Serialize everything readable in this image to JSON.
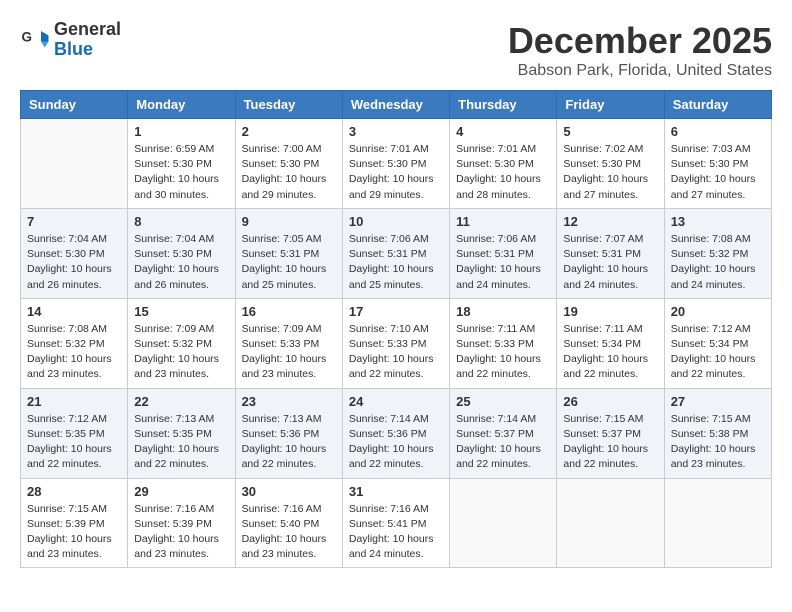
{
  "logo": {
    "general": "General",
    "blue": "Blue"
  },
  "header": {
    "month": "December 2025",
    "location": "Babson Park, Florida, United States"
  },
  "weekdays": [
    "Sunday",
    "Monday",
    "Tuesday",
    "Wednesday",
    "Thursday",
    "Friday",
    "Saturday"
  ],
  "weeks": [
    [
      {
        "day": "",
        "sunrise": "",
        "sunset": "",
        "daylight": ""
      },
      {
        "day": "1",
        "sunrise": "Sunrise: 6:59 AM",
        "sunset": "Sunset: 5:30 PM",
        "daylight": "Daylight: 10 hours and 30 minutes."
      },
      {
        "day": "2",
        "sunrise": "Sunrise: 7:00 AM",
        "sunset": "Sunset: 5:30 PM",
        "daylight": "Daylight: 10 hours and 29 minutes."
      },
      {
        "day": "3",
        "sunrise": "Sunrise: 7:01 AM",
        "sunset": "Sunset: 5:30 PM",
        "daylight": "Daylight: 10 hours and 29 minutes."
      },
      {
        "day": "4",
        "sunrise": "Sunrise: 7:01 AM",
        "sunset": "Sunset: 5:30 PM",
        "daylight": "Daylight: 10 hours and 28 minutes."
      },
      {
        "day": "5",
        "sunrise": "Sunrise: 7:02 AM",
        "sunset": "Sunset: 5:30 PM",
        "daylight": "Daylight: 10 hours and 27 minutes."
      },
      {
        "day": "6",
        "sunrise": "Sunrise: 7:03 AM",
        "sunset": "Sunset: 5:30 PM",
        "daylight": "Daylight: 10 hours and 27 minutes."
      }
    ],
    [
      {
        "day": "7",
        "sunrise": "Sunrise: 7:04 AM",
        "sunset": "Sunset: 5:30 PM",
        "daylight": "Daylight: 10 hours and 26 minutes."
      },
      {
        "day": "8",
        "sunrise": "Sunrise: 7:04 AM",
        "sunset": "Sunset: 5:30 PM",
        "daylight": "Daylight: 10 hours and 26 minutes."
      },
      {
        "day": "9",
        "sunrise": "Sunrise: 7:05 AM",
        "sunset": "Sunset: 5:31 PM",
        "daylight": "Daylight: 10 hours and 25 minutes."
      },
      {
        "day": "10",
        "sunrise": "Sunrise: 7:06 AM",
        "sunset": "Sunset: 5:31 PM",
        "daylight": "Daylight: 10 hours and 25 minutes."
      },
      {
        "day": "11",
        "sunrise": "Sunrise: 7:06 AM",
        "sunset": "Sunset: 5:31 PM",
        "daylight": "Daylight: 10 hours and 24 minutes."
      },
      {
        "day": "12",
        "sunrise": "Sunrise: 7:07 AM",
        "sunset": "Sunset: 5:31 PM",
        "daylight": "Daylight: 10 hours and 24 minutes."
      },
      {
        "day": "13",
        "sunrise": "Sunrise: 7:08 AM",
        "sunset": "Sunset: 5:32 PM",
        "daylight": "Daylight: 10 hours and 24 minutes."
      }
    ],
    [
      {
        "day": "14",
        "sunrise": "Sunrise: 7:08 AM",
        "sunset": "Sunset: 5:32 PM",
        "daylight": "Daylight: 10 hours and 23 minutes."
      },
      {
        "day": "15",
        "sunrise": "Sunrise: 7:09 AM",
        "sunset": "Sunset: 5:32 PM",
        "daylight": "Daylight: 10 hours and 23 minutes."
      },
      {
        "day": "16",
        "sunrise": "Sunrise: 7:09 AM",
        "sunset": "Sunset: 5:33 PM",
        "daylight": "Daylight: 10 hours and 23 minutes."
      },
      {
        "day": "17",
        "sunrise": "Sunrise: 7:10 AM",
        "sunset": "Sunset: 5:33 PM",
        "daylight": "Daylight: 10 hours and 22 minutes."
      },
      {
        "day": "18",
        "sunrise": "Sunrise: 7:11 AM",
        "sunset": "Sunset: 5:33 PM",
        "daylight": "Daylight: 10 hours and 22 minutes."
      },
      {
        "day": "19",
        "sunrise": "Sunrise: 7:11 AM",
        "sunset": "Sunset: 5:34 PM",
        "daylight": "Daylight: 10 hours and 22 minutes."
      },
      {
        "day": "20",
        "sunrise": "Sunrise: 7:12 AM",
        "sunset": "Sunset: 5:34 PM",
        "daylight": "Daylight: 10 hours and 22 minutes."
      }
    ],
    [
      {
        "day": "21",
        "sunrise": "Sunrise: 7:12 AM",
        "sunset": "Sunset: 5:35 PM",
        "daylight": "Daylight: 10 hours and 22 minutes."
      },
      {
        "day": "22",
        "sunrise": "Sunrise: 7:13 AM",
        "sunset": "Sunset: 5:35 PM",
        "daylight": "Daylight: 10 hours and 22 minutes."
      },
      {
        "day": "23",
        "sunrise": "Sunrise: 7:13 AM",
        "sunset": "Sunset: 5:36 PM",
        "daylight": "Daylight: 10 hours and 22 minutes."
      },
      {
        "day": "24",
        "sunrise": "Sunrise: 7:14 AM",
        "sunset": "Sunset: 5:36 PM",
        "daylight": "Daylight: 10 hours and 22 minutes."
      },
      {
        "day": "25",
        "sunrise": "Sunrise: 7:14 AM",
        "sunset": "Sunset: 5:37 PM",
        "daylight": "Daylight: 10 hours and 22 minutes."
      },
      {
        "day": "26",
        "sunrise": "Sunrise: 7:15 AM",
        "sunset": "Sunset: 5:37 PM",
        "daylight": "Daylight: 10 hours and 22 minutes."
      },
      {
        "day": "27",
        "sunrise": "Sunrise: 7:15 AM",
        "sunset": "Sunset: 5:38 PM",
        "daylight": "Daylight: 10 hours and 23 minutes."
      }
    ],
    [
      {
        "day": "28",
        "sunrise": "Sunrise: 7:15 AM",
        "sunset": "Sunset: 5:39 PM",
        "daylight": "Daylight: 10 hours and 23 minutes."
      },
      {
        "day": "29",
        "sunrise": "Sunrise: 7:16 AM",
        "sunset": "Sunset: 5:39 PM",
        "daylight": "Daylight: 10 hours and 23 minutes."
      },
      {
        "day": "30",
        "sunrise": "Sunrise: 7:16 AM",
        "sunset": "Sunset: 5:40 PM",
        "daylight": "Daylight: 10 hours and 23 minutes."
      },
      {
        "day": "31",
        "sunrise": "Sunrise: 7:16 AM",
        "sunset": "Sunset: 5:41 PM",
        "daylight": "Daylight: 10 hours and 24 minutes."
      },
      {
        "day": "",
        "sunrise": "",
        "sunset": "",
        "daylight": ""
      },
      {
        "day": "",
        "sunrise": "",
        "sunset": "",
        "daylight": ""
      },
      {
        "day": "",
        "sunrise": "",
        "sunset": "",
        "daylight": ""
      }
    ]
  ]
}
